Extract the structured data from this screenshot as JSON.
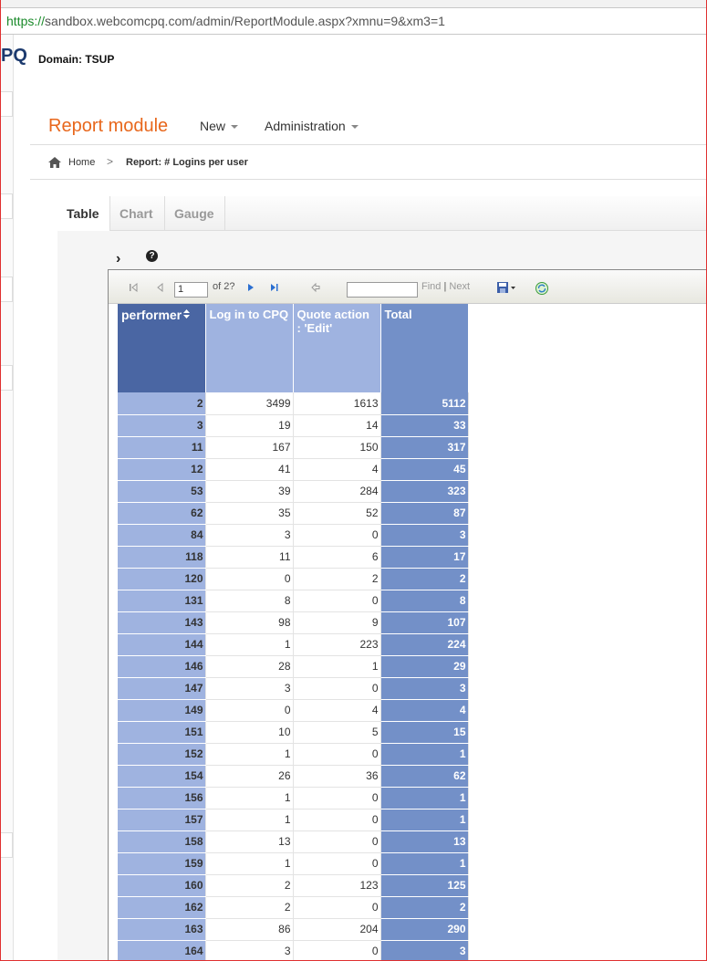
{
  "browser": {
    "url_scheme": "https://",
    "url_rest": "sandbox.webcomcpq.com/admin/ReportModule.aspx?xmnu=9&xm3=1"
  },
  "header": {
    "brand": "PQ",
    "domain": "Domain: TSUP"
  },
  "titlebar": {
    "title": "Report module",
    "menu_new": "New",
    "menu_admin": "Administration"
  },
  "breadcrumb": {
    "home": "Home",
    "separator": ">",
    "current": "Report: # Logins per user"
  },
  "tabs": [
    "Table",
    "Chart",
    "Gauge"
  ],
  "active_tab": "Table",
  "toolbar": {
    "page_value": "1",
    "page_of": "of 2?",
    "find": "Find",
    "pipe": "|",
    "next": "Next"
  },
  "table": {
    "headers": {
      "performer": "performer",
      "col1": "Log in to CPQ",
      "col2": "Quote action : 'Edit'",
      "total": "Total"
    },
    "rows": [
      [
        "2",
        "3499",
        "1613",
        "5112"
      ],
      [
        "3",
        "19",
        "14",
        "33"
      ],
      [
        "11",
        "167",
        "150",
        "317"
      ],
      [
        "12",
        "41",
        "4",
        "45"
      ],
      [
        "53",
        "39",
        "284",
        "323"
      ],
      [
        "62",
        "35",
        "52",
        "87"
      ],
      [
        "84",
        "3",
        "0",
        "3"
      ],
      [
        "118",
        "11",
        "6",
        "17"
      ],
      [
        "120",
        "0",
        "2",
        "2"
      ],
      [
        "131",
        "8",
        "0",
        "8"
      ],
      [
        "143",
        "98",
        "9",
        "107"
      ],
      [
        "144",
        "1",
        "223",
        "224"
      ],
      [
        "146",
        "28",
        "1",
        "29"
      ],
      [
        "147",
        "3",
        "0",
        "3"
      ],
      [
        "149",
        "0",
        "4",
        "4"
      ],
      [
        "151",
        "10",
        "5",
        "15"
      ],
      [
        "152",
        "1",
        "0",
        "1"
      ],
      [
        "154",
        "26",
        "36",
        "62"
      ],
      [
        "156",
        "1",
        "0",
        "1"
      ],
      [
        "157",
        "1",
        "0",
        "1"
      ],
      [
        "158",
        "13",
        "0",
        "13"
      ],
      [
        "159",
        "1",
        "0",
        "1"
      ],
      [
        "160",
        "2",
        "123",
        "125"
      ],
      [
        "162",
        "2",
        "0",
        "2"
      ],
      [
        "163",
        "86",
        "204",
        "290"
      ],
      [
        "164",
        "3",
        "0",
        "3"
      ]
    ]
  },
  "colors": {
    "brand": "#1c3a6e",
    "title": "#e8671c",
    "performer_header": "#4a66a3",
    "performer_cells": "#9fb3e0",
    "total_cells": "#7390c8"
  },
  "icons": {
    "home": "home-icon",
    "help": "help-icon",
    "first": "first-page-icon",
    "prev": "prev-page-icon",
    "next": "next-page-icon",
    "last": "last-page-icon",
    "back": "back-icon",
    "export": "export-icon",
    "refresh": "refresh-icon",
    "sort": "sort-icon",
    "expand": "expand-icon"
  }
}
